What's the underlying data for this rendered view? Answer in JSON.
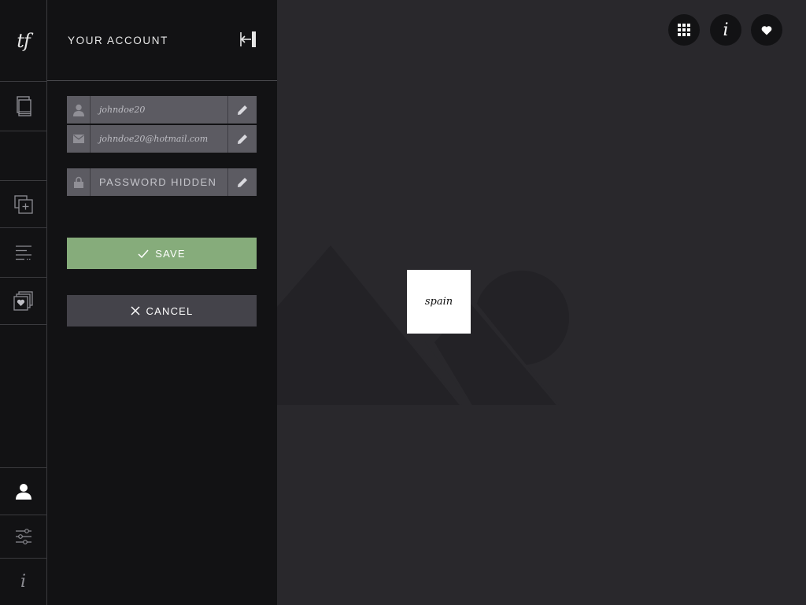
{
  "sidebar": {
    "logo_text": "tf",
    "items": [
      {
        "name": "library-icon"
      },
      {
        "name": "blank-slot"
      },
      {
        "name": "add-layer-icon"
      },
      {
        "name": "list-icon"
      },
      {
        "name": "favorites-icon"
      },
      {
        "name": "user-icon",
        "active": true
      },
      {
        "name": "sliders-icon"
      },
      {
        "name": "info-icon",
        "label": "i"
      }
    ]
  },
  "account": {
    "title": "YOUR ACCOUNT",
    "username": "johndoe20",
    "email": "johndoe20@hotmail.com",
    "password_label": "PASSWORD HIDDEN",
    "save_label": "SAVE",
    "cancel_label": "CANCEL"
  },
  "main": {
    "tag_label": "spain",
    "info_label": "i"
  },
  "colors": {
    "save": "#86ac7b",
    "cancel": "#44434a",
    "field": "#5c5b62",
    "panel": "#121214",
    "canvas": "#29282c"
  }
}
